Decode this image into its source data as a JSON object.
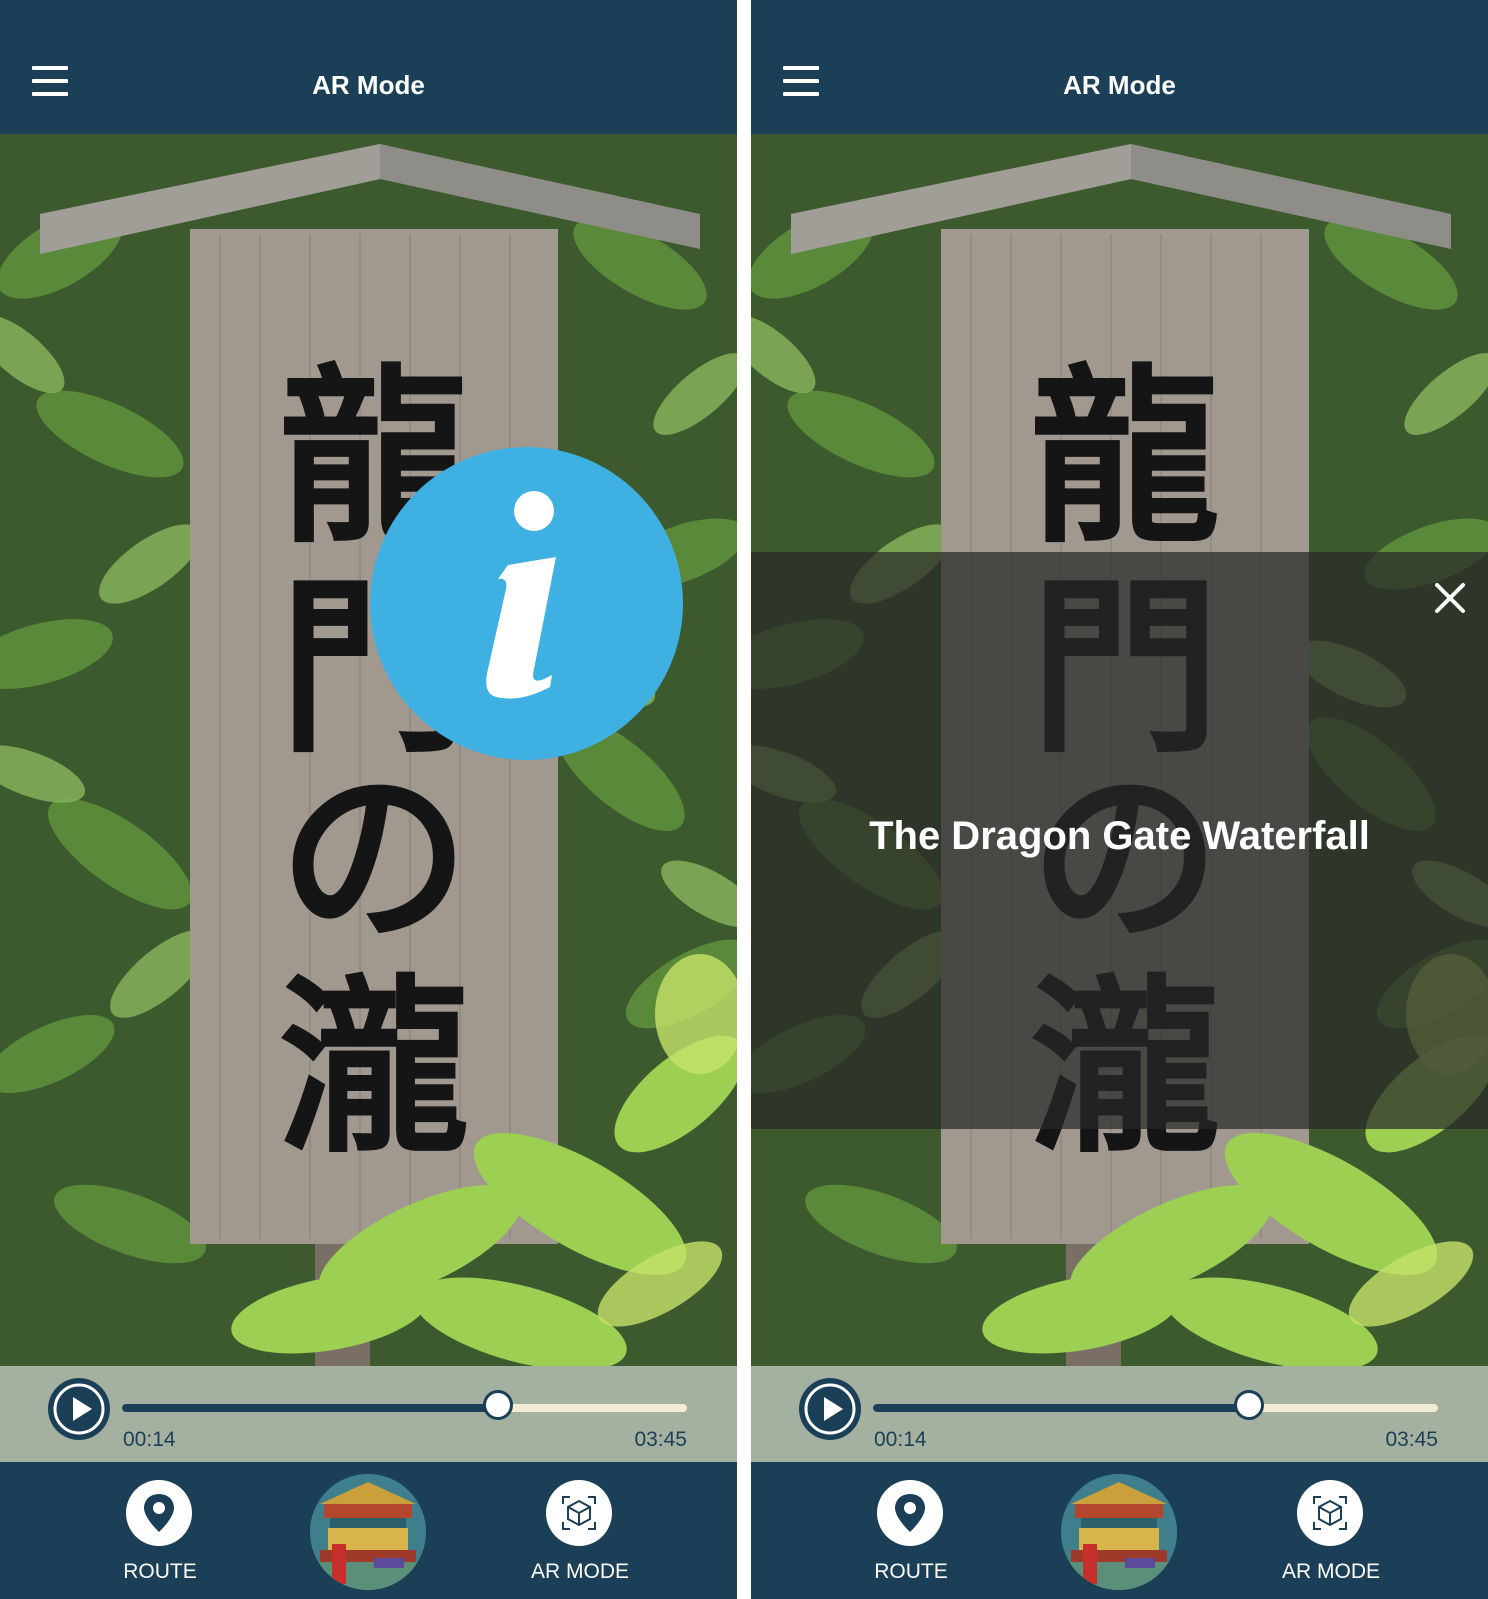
{
  "screens": [
    {
      "header": {
        "title": "AR Mode"
      },
      "sign_text": "龍門の瀧",
      "player": {
        "current_time": "00:14",
        "total_time": "03:45",
        "progress_percent": 66.5
      },
      "nav": {
        "route_label": "ROUTE",
        "ar_label": "AR MODE"
      }
    },
    {
      "header": {
        "title": "AR Mode"
      },
      "sign_text": "龍門の瀧",
      "info_panel": {
        "title": "The Dragon Gate Waterfall"
      },
      "player": {
        "current_time": "00:14",
        "total_time": "03:45",
        "progress_percent": 66.5
      },
      "nav": {
        "route_label": "ROUTE",
        "ar_label": "AR MODE"
      }
    }
  ],
  "colors": {
    "header_bg": "#1a3f57",
    "info_marker": "#3eb0e2",
    "player_bg": "#a4b1a1",
    "track_rest": "#f2ecd4"
  },
  "icons": [
    "menu-icon",
    "info-icon",
    "close-icon",
    "play-icon",
    "location-pin-icon",
    "ar-cube-icon"
  ]
}
